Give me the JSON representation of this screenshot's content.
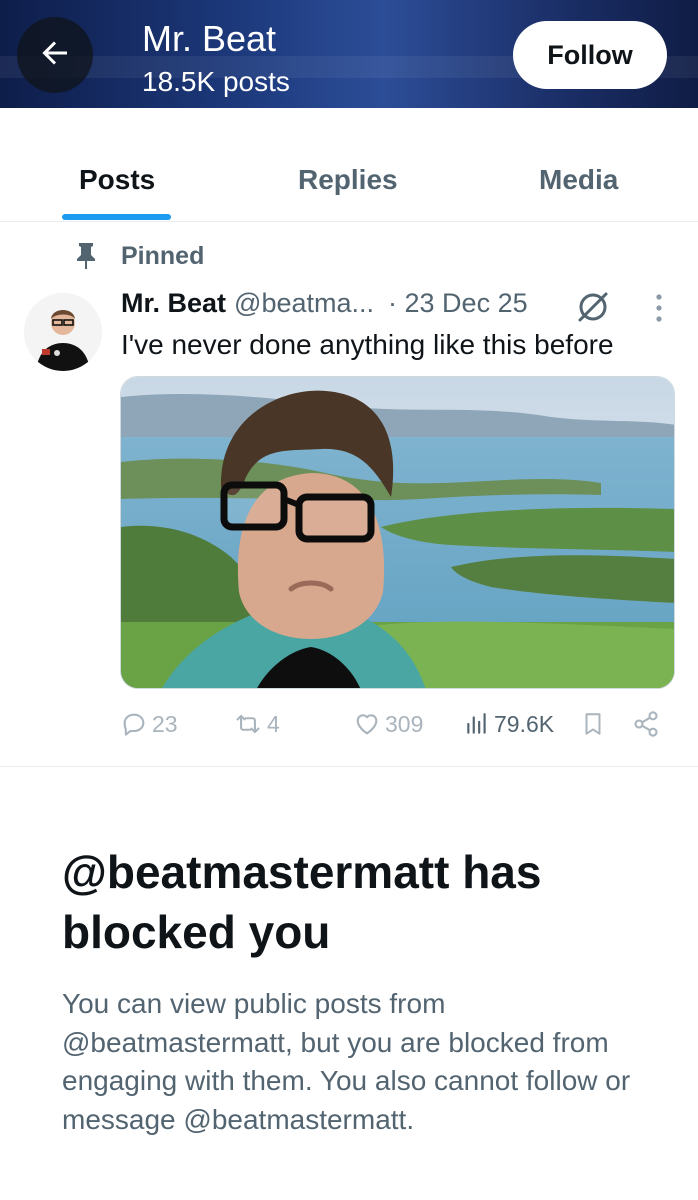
{
  "header": {
    "profile_name": "Mr. Beat",
    "posts_count": "18.5K posts",
    "follow_label": "Follow",
    "back_icon": "arrow-left-icon"
  },
  "tabs": [
    {
      "label": "Posts",
      "active": true
    },
    {
      "label": "Replies",
      "active": false
    },
    {
      "label": "Media",
      "active": false
    }
  ],
  "pinned": {
    "label": "Pinned",
    "icon": "pin-icon"
  },
  "tweet": {
    "author_name": "Mr. Beat",
    "author_handle": "@beatma...",
    "date": "· 23 Dec 25",
    "text": "I've never done anything like this before",
    "media_description_icon": "image",
    "stats": {
      "replies": "23",
      "reposts": "4",
      "likes": "309",
      "views": "79.6K"
    }
  },
  "blocked": {
    "title": "@beatmastermatt has blocked you",
    "description": "You can view public posts from @beatmastermatt, but you are blocked from engaging with them. You also cannot follow or message @beatmastermatt."
  },
  "colors": {
    "accent": "#1d9bf0",
    "text_primary": "#0f1419",
    "text_secondary": "#536471",
    "header_bg": "#1d3a7d"
  }
}
